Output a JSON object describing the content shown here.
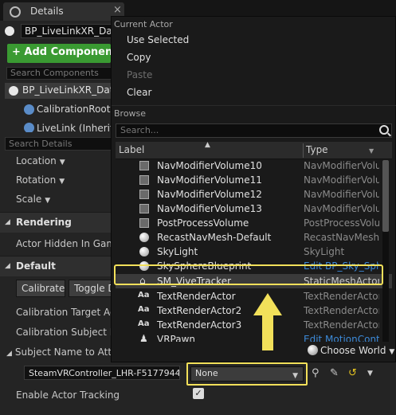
{
  "details_tab": {
    "title": "Details",
    "close": "×"
  },
  "actor": {
    "name": "BP_LiveLinkXR_Data"
  },
  "components": {
    "add_label": "+ Add Component",
    "search_placeholder": "Search Components",
    "root": "BP_LiveLinkXR_Data",
    "children": [
      "CalibrationRoot (",
      "LiveLink (Inherite"
    ]
  },
  "details": {
    "search_placeholder": "Search Details",
    "transform": [
      "Location",
      "Rotation",
      "Scale"
    ],
    "section_rendering": "Rendering",
    "actor_hidden": "Actor Hidden In Game",
    "section_default": "Default",
    "calibrate_label": "Calibrate",
    "toggle_label": "Toggle D",
    "cal_target": "Calibration Target Actor",
    "cal_subject": "Calibration Subject Nam",
    "subject_attach": "Subject Name to Attach",
    "controller_value": "SteamVRController_LHR-F5177944",
    "none_value": "None",
    "enable_tracking": "Enable Actor Tracking",
    "enable_tracking_checked": true
  },
  "popup": {
    "current_actor_heading": "Current Actor",
    "items": [
      {
        "label": "Use Selected",
        "enabled": true
      },
      {
        "label": "Copy",
        "enabled": true
      },
      {
        "label": "Paste",
        "enabled": false
      },
      {
        "label": "Clear",
        "enabled": true
      }
    ],
    "browse_heading": "Browse",
    "search_placeholder": "Search...",
    "col_label": "Label",
    "col_type": "Type",
    "rows": [
      {
        "name": "NavModifierVolume10",
        "type": "NavModifierVolur",
        "icon": "box-icon",
        "link": false
      },
      {
        "name": "NavModifierVolume11",
        "type": "NavModifierVolur",
        "icon": "box-icon",
        "link": false
      },
      {
        "name": "NavModifierVolume12",
        "type": "NavModifierVolur",
        "icon": "box-icon",
        "link": false
      },
      {
        "name": "NavModifierVolume13",
        "type": "NavModifierVolur",
        "icon": "box-icon",
        "link": false
      },
      {
        "name": "PostProcessVolume",
        "type": "PostProcessVolur",
        "icon": "box-icon",
        "link": false
      },
      {
        "name": "RecastNavMesh-Default",
        "type": "RecastNavMesh",
        "icon": "sphere-icon",
        "link": false
      },
      {
        "name": "SkyLight",
        "type": "SkyLight",
        "icon": "sphere-icon",
        "link": false
      },
      {
        "name": "SkySphereBlueprint",
        "type": "Edit BP_Sky_Sph",
        "icon": "sphere-icon",
        "link": true
      },
      {
        "name": "SM_ViveTracker",
        "type": "StaticMeshActor",
        "icon": "mesh-icon",
        "link": false,
        "selected": true
      },
      {
        "name": "TextRenderActor",
        "type": "TextRenderActor",
        "icon": "text-icon",
        "link": false
      },
      {
        "name": "TextRenderActor2",
        "type": "TextRenderActor",
        "icon": "text-icon",
        "link": false
      },
      {
        "name": "TextRenderActor3",
        "type": "TextRenderActor",
        "icon": "text-icon",
        "link": false
      },
      {
        "name": "VRPawn",
        "type": "Edit MotionContr",
        "icon": "pawn-icon",
        "link": true
      }
    ],
    "choose_world": "Choose World"
  },
  "colors": {
    "highlight": "#f2e05a",
    "add_green": "#3a9a32",
    "link_blue": "#3d8ad8"
  }
}
